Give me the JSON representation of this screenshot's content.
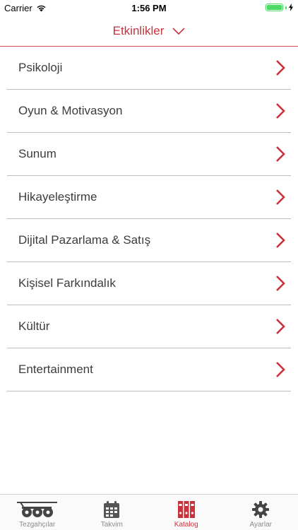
{
  "status_bar": {
    "carrier": "Carrier",
    "time": "1:56 PM"
  },
  "header": {
    "title": "Etkinlikler",
    "icon": "chevron-down-icon"
  },
  "list": {
    "items": [
      {
        "label": "Psikoloji"
      },
      {
        "label": "Oyun & Motivasyon"
      },
      {
        "label": "Sunum"
      },
      {
        "label": "Hikayeleştirme"
      },
      {
        "label": "Dijital Pazarlama & Satış"
      },
      {
        "label": "Kişisel Farkındalık"
      },
      {
        "label": "Kültür"
      },
      {
        "label": "Entertainment"
      }
    ],
    "arrow_icon": "chevron-right-icon"
  },
  "tab_bar": {
    "tabs": [
      {
        "label": "Tezgahçılar",
        "icon": "cart-icon",
        "active": false
      },
      {
        "label": "Takvim",
        "icon": "calendar-icon",
        "active": false
      },
      {
        "label": "Katalog",
        "icon": "binders-icon",
        "active": true
      },
      {
        "label": "Ayarlar",
        "icon": "gear-icon",
        "active": false
      }
    ]
  },
  "colors": {
    "accent": "#c8323a",
    "battery": "#4cd964",
    "text": "#3c3c3c",
    "inactive_tab": "#8a8a8a"
  }
}
